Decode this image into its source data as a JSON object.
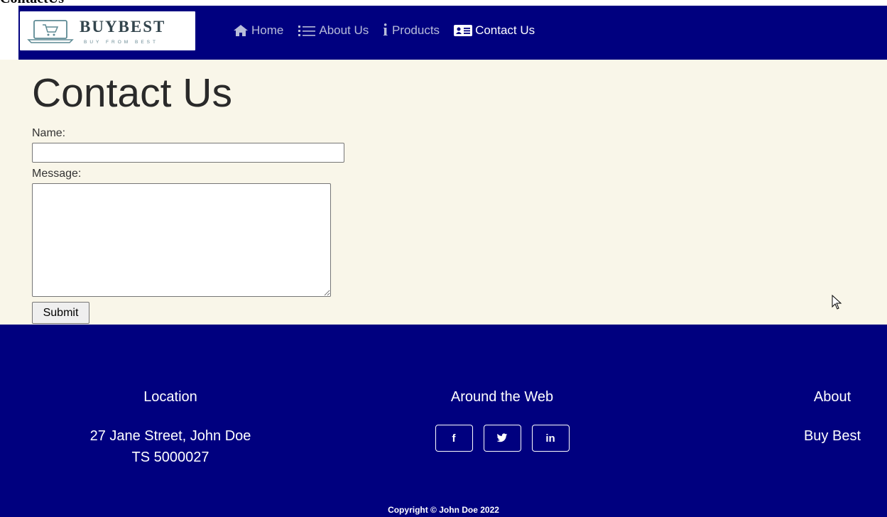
{
  "document": {
    "title": "ContactUs"
  },
  "brand": {
    "name": "BUYBEST",
    "tagline": "BUY FROM BEST"
  },
  "nav": {
    "items": [
      {
        "label": "Home",
        "icon": "home-icon",
        "active": false
      },
      {
        "label": "About Us",
        "icon": "list-icon",
        "active": false
      },
      {
        "label": "Products",
        "icon": "info-icon",
        "active": false
      },
      {
        "label": "Contact Us",
        "icon": "contact-card-icon",
        "active": true
      }
    ]
  },
  "main": {
    "title": "Contact Us",
    "name_label": "Name:",
    "name_value": "",
    "message_label": "Message:",
    "message_value": "",
    "submit_label": "Submit"
  },
  "footer": {
    "location": {
      "heading": "Location",
      "line1": "27 Jane Street, John Doe",
      "line2": "TS 5000027"
    },
    "web": {
      "heading": "Around the Web",
      "links": [
        {
          "label": "f",
          "icon": "facebook-icon"
        },
        {
          "icon": "twitter-icon"
        },
        {
          "label": "in",
          "icon": "linkedin-icon"
        }
      ]
    },
    "about": {
      "heading": "About",
      "text": "Buy Best"
    },
    "copyright": "Copyright © John Doe 2022"
  },
  "colors": {
    "nav_bg": "#00007f",
    "main_bg": "#f9f6e9",
    "nav_link": "#b8bdd9",
    "nav_link_active": "#ffffff"
  }
}
